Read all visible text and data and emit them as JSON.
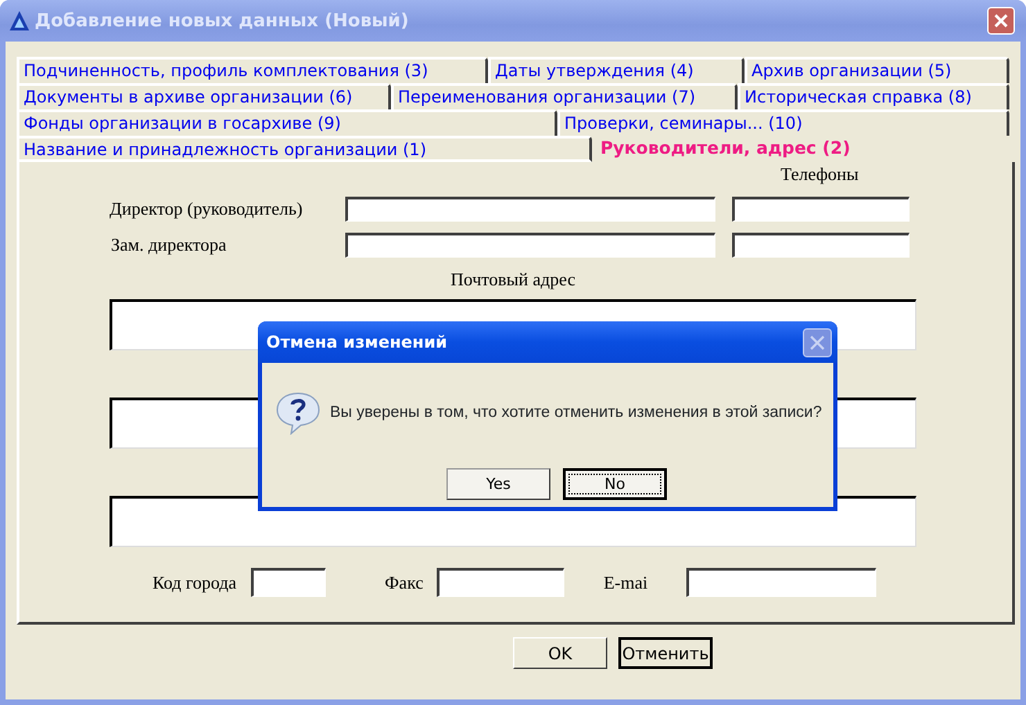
{
  "window": {
    "title": "Добавление новых данных  (Новый)"
  },
  "tab_rows": [
    {
      "tabs": [
        {
          "label": "Подчиненность, профиль комплектования (3)",
          "selected": false
        },
        {
          "label": "Даты утверждения (4)",
          "selected": false
        },
        {
          "label": "Архив организации (5)",
          "selected": false
        }
      ]
    },
    {
      "tabs": [
        {
          "label": "Документы в архиве организации (6)",
          "selected": false
        },
        {
          "label": "Переименования организации (7)",
          "selected": false
        },
        {
          "label": "Историческая справка (8)",
          "selected": false
        }
      ]
    },
    {
      "tabs": [
        {
          "label": "Фонды организации в госархиве (9)",
          "selected": false
        },
        {
          "label": "Проверки, семинары... (10)",
          "selected": false
        }
      ]
    },
    {
      "tabs": [
        {
          "label": "Название и принадлежность организации (1)",
          "selected": false
        },
        {
          "label": "Руководители, адрес (2)",
          "selected": true
        }
      ]
    }
  ],
  "phones_header": "Телефоны",
  "managers": [
    {
      "label": "Директор (руководитель)"
    },
    {
      "label": "Зам. директора"
    }
  ],
  "address_header": "Почтовый адрес",
  "contacts": [
    {
      "label": "Код города"
    },
    {
      "label": "Факс"
    },
    {
      "label": "E-mai"
    }
  ],
  "buttons": [
    {
      "label": "OK",
      "default": false
    },
    {
      "label": "Отменить",
      "default": true
    }
  ],
  "dialog": {
    "title": "Отмена изменений",
    "message": "Вы уверены в том, что хотите отменить изменения в этой записи?",
    "buttons": [
      {
        "label": "Yes",
        "focused": false
      },
      {
        "label": "No",
        "focused": true
      }
    ]
  }
}
